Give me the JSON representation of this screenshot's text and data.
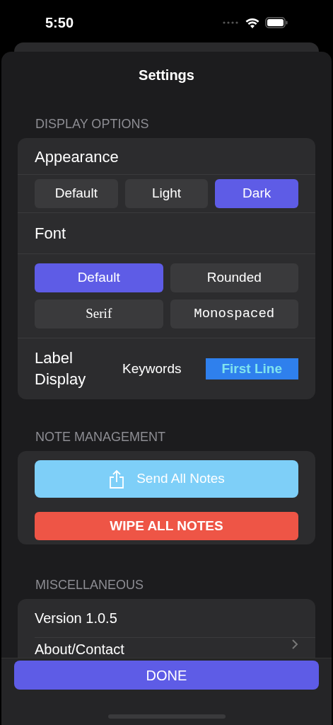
{
  "status_bar": {
    "time": "5:50"
  },
  "title": "Settings",
  "display_options": {
    "header": "DISPLAY OPTIONS",
    "appearance": {
      "label": "Appearance",
      "options": [
        {
          "label": "Default",
          "selected": false
        },
        {
          "label": "Light",
          "selected": false
        },
        {
          "label": "Dark",
          "selected": true
        }
      ]
    },
    "font": {
      "label": "Font",
      "options": [
        {
          "label": "Default",
          "kind": "sans",
          "selected": true
        },
        {
          "label": "Rounded",
          "kind": "sans",
          "selected": false
        },
        {
          "label": "Serif",
          "kind": "serif",
          "selected": false
        },
        {
          "label": "Monospaced",
          "kind": "mono",
          "selected": false
        }
      ]
    },
    "label_display": {
      "label": "Label Display",
      "options": [
        {
          "label": "Keywords",
          "selected": false
        },
        {
          "label": "First Line",
          "selected": true
        }
      ]
    }
  },
  "note_management": {
    "header": "NOTE MANAGEMENT",
    "buttons": [
      {
        "label": "Send All Notes",
        "kind": "share"
      },
      {
        "label": "WIPE ALL NOTES",
        "kind": "danger"
      }
    ]
  },
  "miscellaneous": {
    "header": "MISCELLANEOUS",
    "rows": [
      {
        "label": "Version 1.0.5",
        "kind": "info"
      },
      {
        "label": "About/Contact",
        "kind": "link"
      }
    ]
  },
  "done_button": "DONE"
}
